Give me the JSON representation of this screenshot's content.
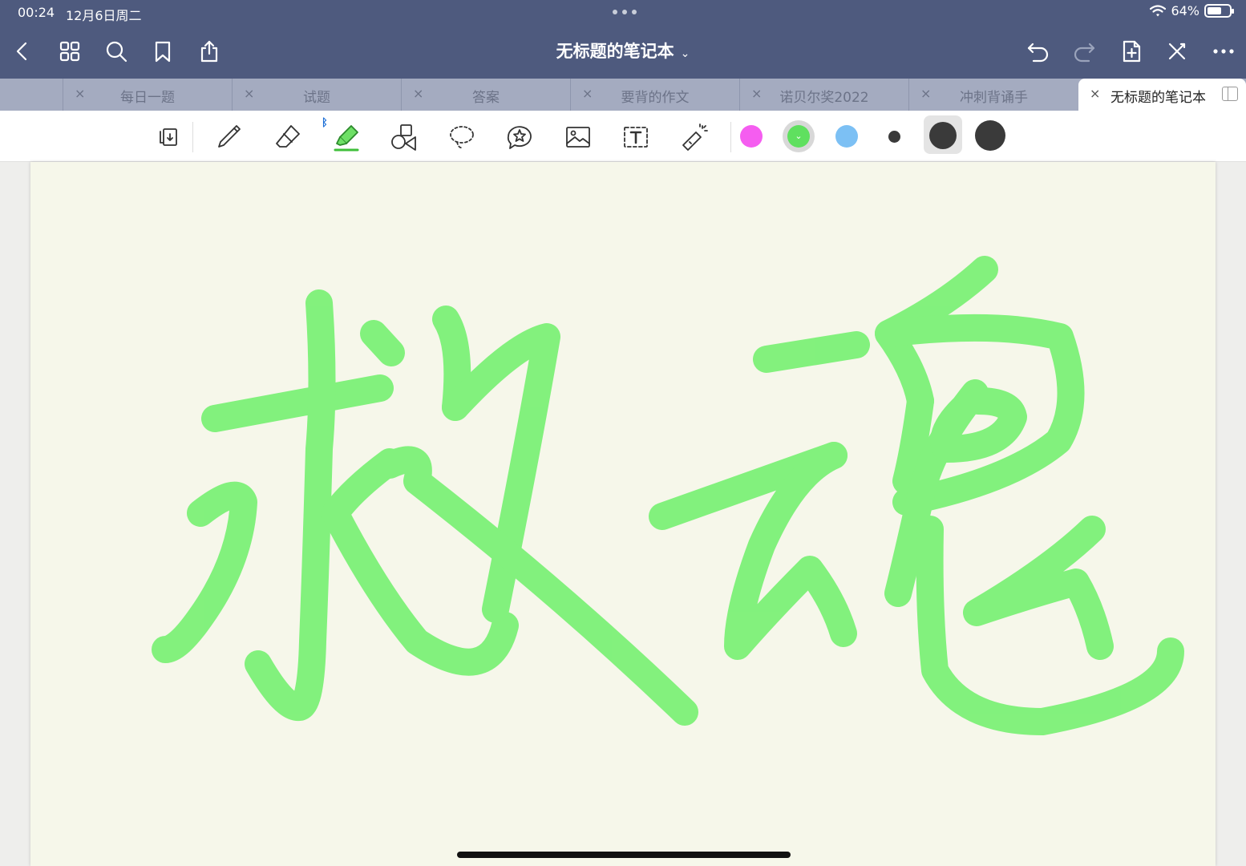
{
  "status": {
    "time": "00:24",
    "date": "12月6日周二",
    "battery": "64%",
    "battery_level": 0.64
  },
  "header": {
    "title": "无标题的笔记本"
  },
  "tabs": [
    {
      "label": "每日一题",
      "active": false
    },
    {
      "label": "试题",
      "active": false
    },
    {
      "label": "答案",
      "active": false
    },
    {
      "label": "要背的作文",
      "active": false
    },
    {
      "label": "诺贝尔奖2022",
      "active": false
    },
    {
      "label": "冲刺背诵手",
      "active": false
    },
    {
      "label": "无标题的笔记本",
      "active": true
    }
  ],
  "tab_close_glyph": "×",
  "toolbar": {
    "tools": [
      "page-view-icon",
      "pen-icon",
      "eraser-icon",
      "highlighter-icon",
      "shapes-icon",
      "lasso-icon",
      "sticker-icon",
      "image-icon",
      "text-icon",
      "laser-pointer-icon"
    ],
    "selected_tool": "highlighter-icon",
    "colors": [
      "#f55df0",
      "#5fe05f",
      "#7cc0f4"
    ],
    "selected_color": "#5fe05f",
    "sizes": [
      "small",
      "medium",
      "large"
    ],
    "selected_size": "medium"
  },
  "canvas": {
    "ink_color": "#6ef06a",
    "handwriting": "救魂"
  }
}
